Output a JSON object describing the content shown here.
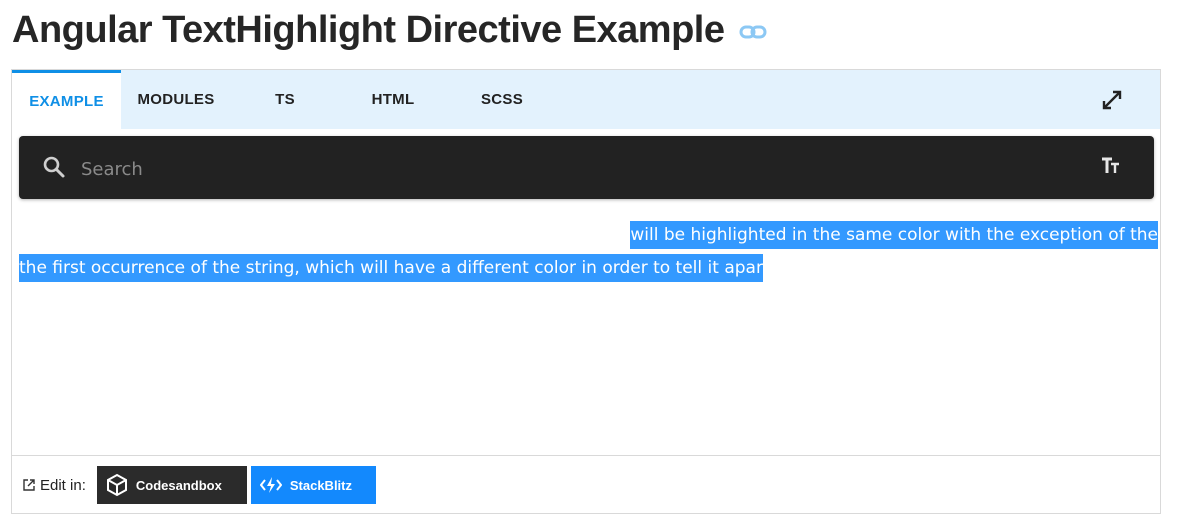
{
  "page": {
    "title": "Angular TextHighlight Directive Example"
  },
  "tabs": [
    {
      "label": "EXAMPLE",
      "active": true
    },
    {
      "label": "MODULES",
      "active": false
    },
    {
      "label": "TS",
      "active": false
    },
    {
      "label": "HTML",
      "active": false
    },
    {
      "label": "SCSS",
      "active": false
    }
  ],
  "search": {
    "placeholder": "Search",
    "value": ""
  },
  "content": {
    "line1": "will be highlighted in the same color with the exception of the",
    "line2": "the first occurrence of the string, which will have a different color in order to tell it apar"
  },
  "footer": {
    "edit_label": "Edit in:",
    "codesandbox_label": "Codesandbox",
    "stackblitz_label": "StackBlitz"
  },
  "colors": {
    "accent": "#0f8fe6",
    "tabbar_bg": "#e3f2fd",
    "highlight": "#3399ff",
    "searchbar_bg": "#222222",
    "codesandbox_bg": "#2b2b2b",
    "stackblitz_bg": "#1389fd"
  },
  "icons": [
    "link-icon",
    "expand-icon",
    "search-icon",
    "text-size-icon",
    "external-link-icon",
    "codesandbox-icon",
    "stackblitz-icon"
  ]
}
